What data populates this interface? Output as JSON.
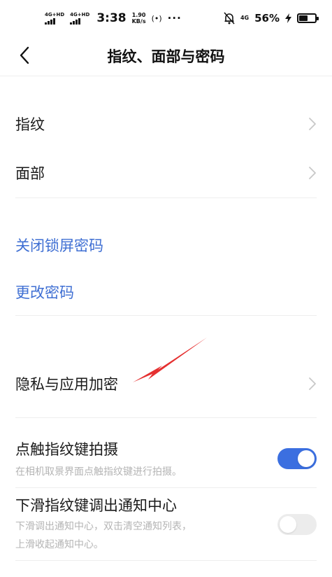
{
  "status_bar": {
    "signal1_label": "4G+HD",
    "signal2_label": "4G+HD",
    "time": "3:38",
    "speed_value": "1.90",
    "speed_unit": "KB/s",
    "hotspot": "(•)",
    "more": "···",
    "net_4g": "4G",
    "battery_percent": "56%",
    "battery_level": 0.56
  },
  "header": {
    "title": "指纹、面部与密码"
  },
  "rows": {
    "fingerprint": "指纹",
    "face": "面部",
    "close_lock_password": "关闭锁屏密码",
    "change_password": "更改密码",
    "privacy_encryption": "隐私与应用加密",
    "touch_capture": {
      "label": "点触指纹键拍摄",
      "description": "在相机取景界面点触指纹键进行拍摄。",
      "enabled": true
    },
    "swipe_notification": {
      "label": "下滑指纹键调出通知中心",
      "description_line1": "下滑调出通知中心，双击清空通知列表，",
      "description_line2": "上滑收起通知中心。",
      "enabled": false
    }
  },
  "colors": {
    "link": "#3f6fd3",
    "toggle_on": "#3b6fe0",
    "annotation_arrow": "#e53030"
  },
  "icons": {
    "back": "chevron-left-icon",
    "row_chevron": "chevron-right-icon"
  }
}
